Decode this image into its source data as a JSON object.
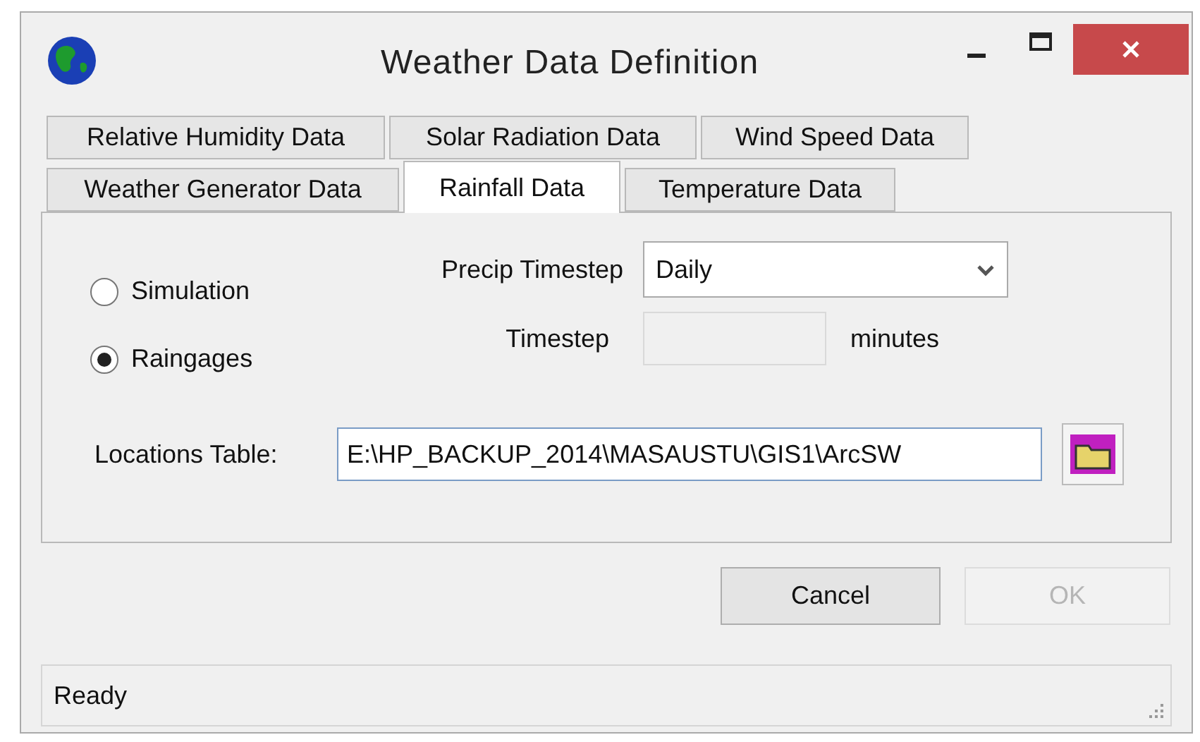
{
  "window": {
    "title": "Weather Data Definition"
  },
  "tab_rows": [
    [
      {
        "label": "Relative Humidity Data",
        "selected": false
      },
      {
        "label": "Solar Radiation Data",
        "selected": false
      },
      {
        "label": "Wind Speed Data",
        "selected": false
      }
    ],
    [
      {
        "label": "Weather Generator Data",
        "selected": false
      },
      {
        "label": "Rainfall Data",
        "selected": true
      },
      {
        "label": "Temperature Data",
        "selected": false
      }
    ]
  ],
  "source_options": [
    {
      "label": "Simulation",
      "selected": false
    },
    {
      "label": "Raingages",
      "selected": true
    }
  ],
  "precip_timestep": {
    "label": "Precip Timestep",
    "value": "Daily"
  },
  "timestep": {
    "label": "Timestep",
    "unit": "minutes",
    "disabled": true
  },
  "locations_table": {
    "label": "Locations Table:",
    "value": "E:\\HP_BACKUP_2014\\MASAUSTU\\GIS1\\ArcSW"
  },
  "buttons": [
    {
      "label": "Cancel",
      "disabled": false
    },
    {
      "label": "OK",
      "disabled": true
    }
  ],
  "status_bar": "Ready"
}
